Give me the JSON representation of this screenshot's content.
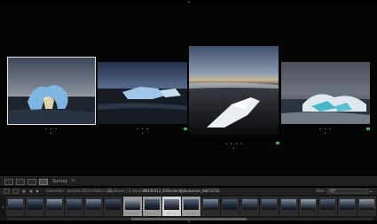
{
  "toolbar": {
    "mode_label": "Survey",
    "mode_arrow": "⇆"
  },
  "filmstrip_header": {
    "page_numbers": "1  2",
    "nav_back": "◀",
    "nav_forward": "▶",
    "collection": "Collection : Iceland 2014 Hidden Low...",
    "photo_count": "22 photos / 4 selected /",
    "filename": "20140312_ICEIcelandJokulsarlon_8467.CR2",
    "filename_arrow": "▾",
    "filter_label": "Filter :",
    "filter_value": "Off"
  },
  "survey": {
    "photos": [
      {
        "name": "ice-arch-sunrise",
        "stars": "• • • •",
        "active": true
      },
      {
        "name": "ice-chunk-shore",
        "stars": "• • • •",
        "active": false
      },
      {
        "name": "ice-black-sand",
        "stars": "• • • • •",
        "active": false
      },
      {
        "name": "wave-ice-beach",
        "stars": "• • • •",
        "active": false
      }
    ]
  },
  "filmstrip": {
    "stars": "••••"
  },
  "colors": {
    "pick_flag": "#3bb54a",
    "active_border": "#e6e6e6",
    "background": "#000000"
  }
}
